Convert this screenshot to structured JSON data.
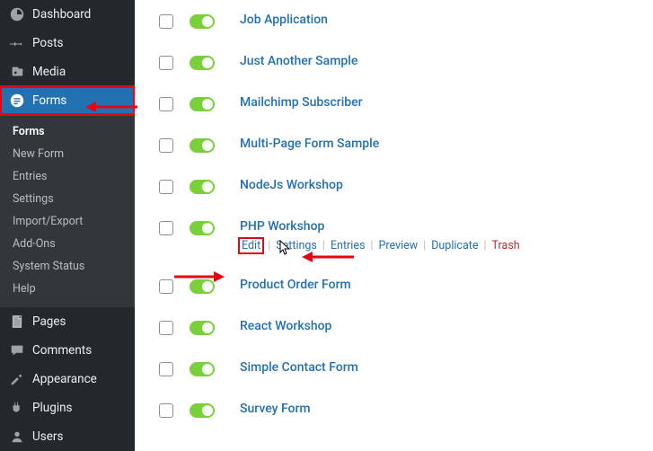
{
  "sidebar": {
    "dashboard": "Dashboard",
    "posts": "Posts",
    "media": "Media",
    "forms": "Forms",
    "pages": "Pages",
    "comments": "Comments",
    "appearance": "Appearance",
    "plugins": "Plugins",
    "users": "Users"
  },
  "submenu": {
    "forms": "Forms",
    "new_form": "New Form",
    "entries": "Entries",
    "settings": "Settings",
    "import_export": "Import/Export",
    "add_ons": "Add-Ons",
    "system_status": "System Status",
    "help": "Help"
  },
  "forms": {
    "job_application": "Job Application",
    "just_another_sample": "Just Another Sample",
    "mailchimp_subscriber": "Mailchimp Subscriber",
    "multi_page_form_sample": "Multi-Page Form Sample",
    "nodejs_workshop": "NodeJs Workshop",
    "php_workshop": "PHP Workshop",
    "product_order_form": "Product Order Form",
    "react_workshop": "React Workshop",
    "simple_contact_form": "Simple Contact Form",
    "survey_form": "Survey Form"
  },
  "actions": {
    "edit": "Edit",
    "settings": "Settings",
    "entries": "Entries",
    "preview": "Preview",
    "duplicate": "Duplicate",
    "trash": "Trash"
  }
}
